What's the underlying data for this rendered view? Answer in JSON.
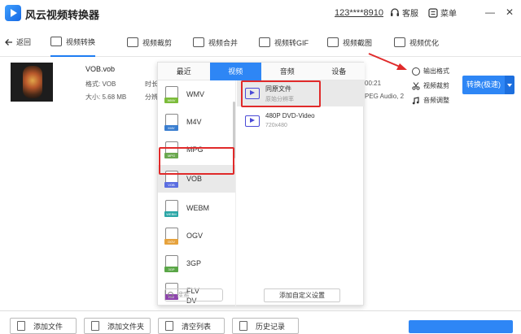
{
  "app": {
    "title": "风云视频转换器",
    "account": "123****8910",
    "service_label": "客服",
    "menu_label": "菜单",
    "minimize": "—",
    "close": "✕"
  },
  "nav": {
    "back_label": "返回",
    "tabs": [
      {
        "label": "视频转换",
        "icon": "video-convert-icon"
      },
      {
        "label": "视频裁剪",
        "icon": "video-crop-icon"
      },
      {
        "label": "视频合并",
        "icon": "video-merge-icon"
      },
      {
        "label": "视频转GIF",
        "icon": "gif-icon"
      },
      {
        "label": "视频截图",
        "icon": "screenshot-icon"
      },
      {
        "label": "视频优化",
        "icon": "optimize-icon"
      }
    ]
  },
  "file": {
    "name": "VOB.vob",
    "format": "格式: VOB",
    "size": "大小: 5.68 MB",
    "duration_label": "时长",
    "resolution_label": "分辨",
    "time_partial": "00:21",
    "codec_partial": "PEG Audio, 2"
  },
  "actions": {
    "output_format": "输出格式",
    "video_crop": "视频裁剪",
    "audio_adjust": "音频调整",
    "convert_label": "转换(极速)"
  },
  "popup": {
    "tabs": [
      "最近",
      "视频",
      "音频",
      "设备"
    ],
    "active_tab": 1,
    "formats": [
      {
        "label": "WMV",
        "tag_color": "#7cbc3a"
      },
      {
        "label": "M4V",
        "tag_color": "#3a7ed0"
      },
      {
        "label": "MPG",
        "tag_color": "#6aa84f"
      },
      {
        "label": "VOB",
        "tag_color": "#5b6ee1"
      },
      {
        "label": "WEBM",
        "tag_color": "#2aa6a6"
      },
      {
        "label": "OGV",
        "tag_color": "#e6a23c"
      },
      {
        "label": "3GP",
        "tag_color": "#5aa647"
      },
      {
        "label": "FLV",
        "tag_color": "#8e44ad"
      },
      {
        "label": "DV",
        "tag_color": "#555555"
      }
    ],
    "selected_format": "VOB",
    "options": [
      {
        "name": "同原文件",
        "sub": "原始分辨率"
      },
      {
        "name": "480P DVD-Video",
        "sub": "720x480"
      }
    ],
    "search_placeholder": "搜索",
    "custom_button": "添加自定义设置"
  },
  "bottom": {
    "add_file": "添加文件",
    "add_folder": "添加文件夹",
    "clear_list": "清空列表",
    "history": "历史记录"
  },
  "colors": {
    "accent": "#2e86f5",
    "highlight_red": "#e02a2a"
  }
}
